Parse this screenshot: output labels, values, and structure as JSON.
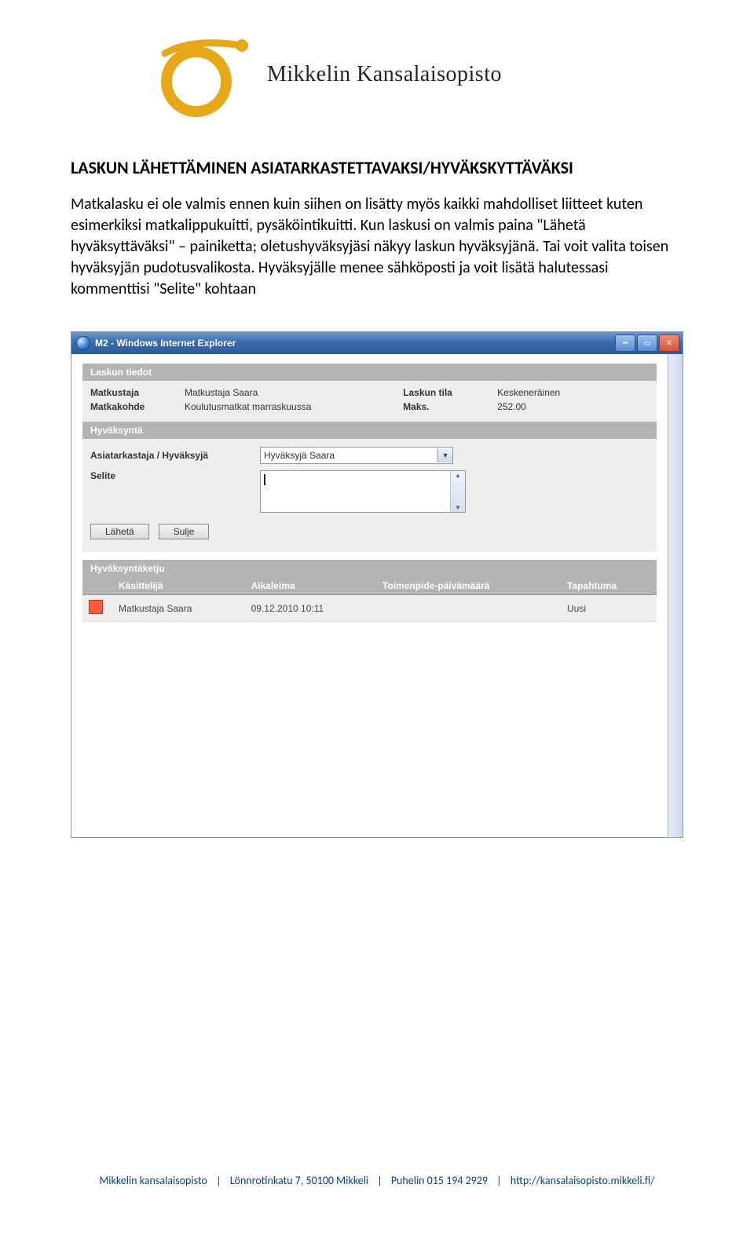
{
  "header": {
    "brand": "Mikkelin Kansalaisopisto"
  },
  "doc": {
    "heading": "LASKUN LÄHETTÄMINEN ASIATARKASTETTAVAKSI/HYVÄKSKYTTÄVÄKSI",
    "para": "Matkalasku ei ole valmis ennen kuin siihen on lisätty myös kaikki mahdolliset liitteet kuten esimerkiksi matkalippukuitti, pysäköintikuitti. Kun laskusi on valmis paina \"Lähetä hyväksyttäväksi\" – painiketta; oletushyväksyjäsi näkyy laskun hyväksyjänä. Tai voit valita toisen hyväksyjän pudotusvalikosta. Hyväksyjälle menee sähköposti ja voit lisätä halutessasi kommenttisi \"Selite\" kohtaan"
  },
  "window": {
    "title": "M2 - Windows Internet Explorer",
    "sections": {
      "tiedot_title": "Laskun tiedot",
      "hyvaksynta_title": "Hyväksyntä",
      "ketju_title": "Hyväksyntäketju"
    },
    "tiedot": {
      "traveler_label": "Matkustaja",
      "traveler_value": "Matkustaja Saara",
      "dest_label": "Matkakohde",
      "dest_value": "Koulutusmatkat marraskuussa",
      "status_label": "Laskun tila",
      "status_value": "Keskeneräinen",
      "max_label": "Maks.",
      "max_value": "252.00"
    },
    "form": {
      "approver_label": "Asiatarkastaja / Hyväksyjä",
      "approver_value": "Hyväksyjä Saara",
      "selite_label": "Selite"
    },
    "buttons": {
      "send": "Lähetä",
      "close": "Sulje"
    },
    "table": {
      "col1": "Käsittelijä",
      "col2": "Aikaleima",
      "col3": "Toimenpide-päivämäärä",
      "col4": "Tapahtuma",
      "row": {
        "handler": "Matkustaja Saara",
        "timestamp": "09.12.2010 10:11",
        "action_date": "",
        "event": "Uusi"
      }
    }
  },
  "footer": {
    "org": "Mikkelin kansalaisopisto",
    "addr": "Lönnrotinkatu 7, 50100 Mikkeli",
    "phone": "Puhelin 015 194 2929",
    "url": "http://kansalaisopisto.mikkeli.fi/"
  }
}
